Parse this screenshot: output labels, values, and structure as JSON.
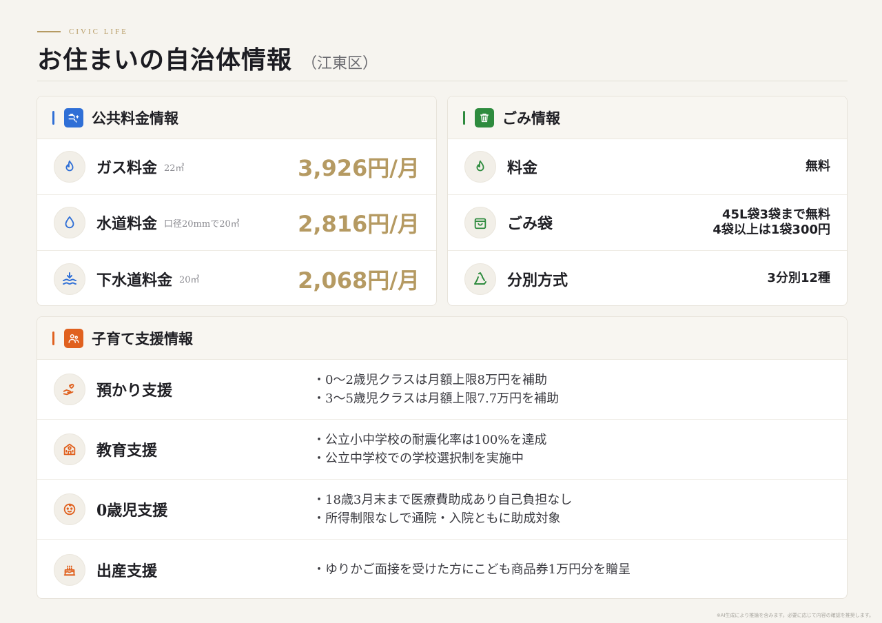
{
  "header": {
    "eyebrow": "CIVIC LIFE",
    "title": "お住まいの自治体情報",
    "subtitle": "（江東区）"
  },
  "colors": {
    "accent_gold": "#b59a62",
    "blue": "#2f6fd6",
    "green": "#2e8b3e",
    "orange": "#e0611f"
  },
  "utilities": {
    "title": "公共料金情報",
    "icon": "water-faucet-icon",
    "items": [
      {
        "icon": "flame-icon",
        "label": "ガス料金",
        "note": "22㎥",
        "price": "3,926円/月"
      },
      {
        "icon": "water-drop-icon",
        "label": "水道料金",
        "note": "口径20mmで20㎥",
        "price": "2,816円/月"
      },
      {
        "icon": "sewage-waves-icon",
        "label": "下水道料金",
        "note": "20㎥",
        "price": "2,068円/月"
      }
    ]
  },
  "garbage": {
    "title": "ごみ情報",
    "icon": "trash-can-icon",
    "items": [
      {
        "icon": "flame-icon",
        "label": "料金",
        "value_lines": [
          "無料"
        ]
      },
      {
        "icon": "bag-icon",
        "label": "ごみ袋",
        "value_lines": [
          "45L袋3袋まで無料",
          "4袋以上は1袋300円"
        ]
      },
      {
        "icon": "recycle-icon",
        "label": "分別方式",
        "value_lines": [
          "3分別12種"
        ]
      }
    ]
  },
  "childcare": {
    "title": "子育て支援情報",
    "icon": "family-icon",
    "items": [
      {
        "icon": "hand-heart-icon",
        "label": "預かり支援",
        "lines": [
          "・0〜2歳児クラスは月額上限8万円を補助",
          "・3〜5歳児クラスは月額上限7.7万円を補助"
        ]
      },
      {
        "icon": "school-icon",
        "label": "教育支援",
        "lines": [
          "・公立小中学校の耐震化率は100%を達成",
          "・公立中学校での学校選択制を実施中"
        ]
      },
      {
        "icon": "baby-face-icon",
        "label": "0歳児支援",
        "lines": [
          "・18歳3月末まで医療費助成あり自己負担なし",
          "・所得制限なしで通院・入院ともに助成対象"
        ]
      },
      {
        "icon": "cake-icon",
        "label": "出産支援",
        "lines": [
          "・ゆりかご面接を受けた方にこども商品券1万円分を贈呈"
        ]
      }
    ]
  },
  "footnote": "※AI生成により推論を含みます。必要に応じて内容の確認を推奨します。"
}
